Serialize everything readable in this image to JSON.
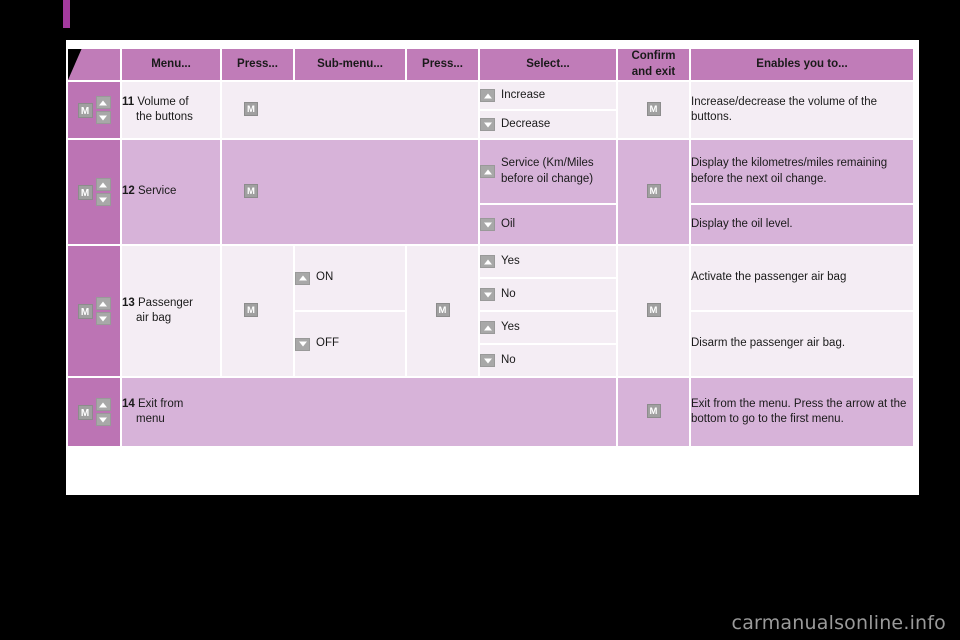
{
  "watermark": "carmanualsonline.info",
  "colors": {
    "tab_marker": "#a33a9e",
    "header_bg": "#c07cb8",
    "row_light": "#f4edf4",
    "row_lilac": "#d7b3d9",
    "nav_deep": "#bc74b4",
    "page_bg": "#ffffff",
    "backdrop": "#000000"
  },
  "icons": {
    "m_button": "M",
    "arrow_up": "up-arrow-icon",
    "arrow_down": "down-arrow-icon"
  },
  "table": {
    "headers": [
      "",
      "Menu...",
      "Press...",
      "Sub-menu...",
      "Press...",
      "Select...",
      "Confirm and exit",
      "Enables you to..."
    ],
    "header_confirm_line1": "Confirm",
    "header_confirm_line2": "and exit",
    "rows": [
      {
        "id": "row-11",
        "number": "11",
        "menu_line1": "Volume of",
        "menu_line2": "the buttons",
        "press": "M",
        "submenu": "",
        "press2": "",
        "selects": [
          {
            "arrow": "up",
            "label": "Increase"
          },
          {
            "arrow": "down",
            "label": "Decrease"
          }
        ],
        "confirm": "M",
        "descriptions": [
          "Increase/decrease the volume of the buttons."
        ]
      },
      {
        "id": "row-12",
        "number": "12",
        "menu_line1": "Service",
        "menu_line2": "",
        "press": "M",
        "submenu": "",
        "press2": "",
        "selects": [
          {
            "arrow": "up",
            "label": "Service (Km/Miles before oil change)"
          },
          {
            "arrow": "down",
            "label": "Oil"
          }
        ],
        "confirm": "M",
        "descriptions": [
          "Display the kilometres/miles remaining before the next oil change.",
          "Display the oil level."
        ]
      },
      {
        "id": "row-13",
        "number": "13",
        "menu_line1": "Passenger",
        "menu_line2": "air bag",
        "press": "M",
        "submenus": [
          {
            "arrow": "up",
            "label": "ON"
          },
          {
            "arrow": "down",
            "label": "OFF"
          }
        ],
        "press2": "M",
        "selects": [
          {
            "arrow": "up",
            "label": "Yes"
          },
          {
            "arrow": "down",
            "label": "No"
          },
          {
            "arrow": "up",
            "label": "Yes"
          },
          {
            "arrow": "down",
            "label": "No"
          }
        ],
        "confirm": "M",
        "descriptions": [
          "Activate the passenger air bag",
          "Disarm the passenger air bag."
        ]
      },
      {
        "id": "row-14",
        "number": "14",
        "menu_line1": "Exit from",
        "menu_line2": "menu",
        "press": "",
        "submenu": "",
        "press2": "",
        "selects": [],
        "confirm": "M",
        "descriptions": [
          "Exit from the menu. Press the arrow at the bottom to go to the first menu."
        ]
      }
    ]
  }
}
